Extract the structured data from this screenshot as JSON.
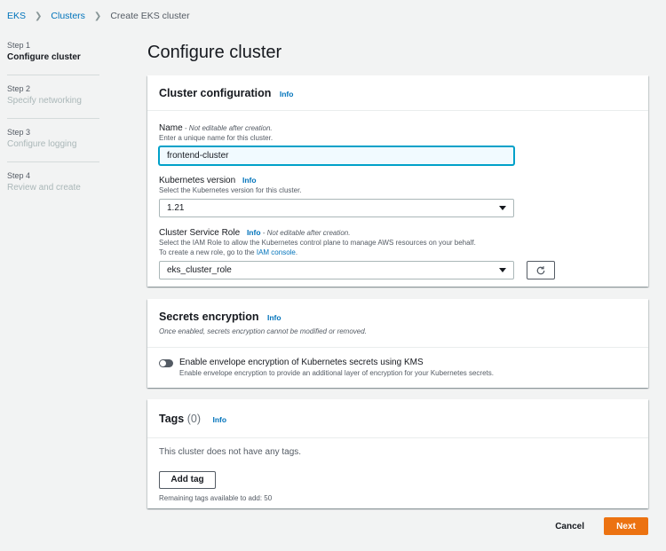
{
  "breadcrumb": {
    "items": [
      "EKS",
      "Clusters"
    ],
    "current": "Create EKS cluster"
  },
  "steps": [
    {
      "num": "Step 1",
      "label": "Configure cluster"
    },
    {
      "num": "Step 2",
      "label": "Specify networking"
    },
    {
      "num": "Step 3",
      "label": "Configure logging"
    },
    {
      "num": "Step 4",
      "label": "Review and create"
    }
  ],
  "page_title": "Configure cluster",
  "cluster_config": {
    "title": "Cluster configuration",
    "info": "Info",
    "name": {
      "label": "Name",
      "note": " - Not editable after creation.",
      "desc": "Enter a unique name for this cluster.",
      "value": "frontend-cluster"
    },
    "k8s_version": {
      "label": "Kubernetes version",
      "info": "Info",
      "desc": "Select the Kubernetes version for this cluster.",
      "value": "1.21"
    },
    "service_role": {
      "label": "Cluster Service Role",
      "info": "Info",
      "note": " - Not editable after creation.",
      "desc1": "Select the IAM Role to allow the Kubernetes control plane to manage AWS resources on your behalf.",
      "desc2_prefix": "To create a new role, go to the ",
      "desc2_link": "IAM console",
      "desc2_suffix": ".",
      "value": "eks_cluster_role"
    }
  },
  "secrets": {
    "title": "Secrets encryption",
    "info": "Info",
    "subtitle": "Once enabled, secrets encryption cannot be modified or removed.",
    "toggle_label": "Enable envelope encryption of Kubernetes secrets using KMS",
    "toggle_desc": "Enable envelope encryption to provide an additional layer of encryption for your Kubernetes secrets.",
    "enabled": false
  },
  "tags": {
    "title": "Tags",
    "count": "(0)",
    "info": "Info",
    "empty": "This cluster does not have any tags.",
    "add_button": "Add tag",
    "remaining": "Remaining tags available to add: 50"
  },
  "footer": {
    "cancel": "Cancel",
    "next": "Next"
  },
  "colors": {
    "primary": "#ec7211",
    "link": "#0073bb",
    "focus": "#00a1c9"
  }
}
